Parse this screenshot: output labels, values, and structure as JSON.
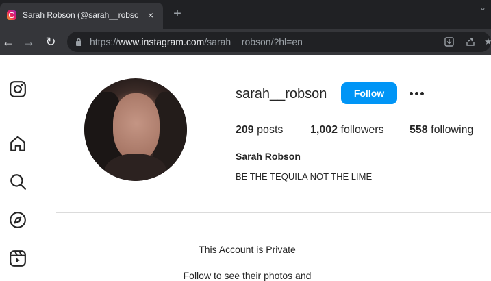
{
  "browser": {
    "tab_title": "Sarah Robson (@sarah__robson)",
    "tab_close": "×",
    "new_tab": "+",
    "url_scheme": "https://",
    "url_host": "www.instagram.com",
    "url_path": "/sarah__robson/?hl=en"
  },
  "nav": {
    "items": [
      "instagram-logo",
      "home",
      "search",
      "explore",
      "reels"
    ]
  },
  "profile": {
    "username": "sarah__robson",
    "follow_label": "Follow",
    "posts_count": "209",
    "posts_label": "posts",
    "followers_count": "1,002",
    "followers_label": "followers",
    "following_count": "558",
    "following_label": "following",
    "full_name": "Sarah Robson",
    "bio": "BE THE TEQUILA NOT THE LIME"
  },
  "private_notice": {
    "title": "This Account is Private",
    "subtitle": "Follow to see their photos and"
  },
  "colors": {
    "accent": "#0095f6",
    "chrome_dark": "#202124",
    "chrome_toolbar": "#35363a"
  }
}
